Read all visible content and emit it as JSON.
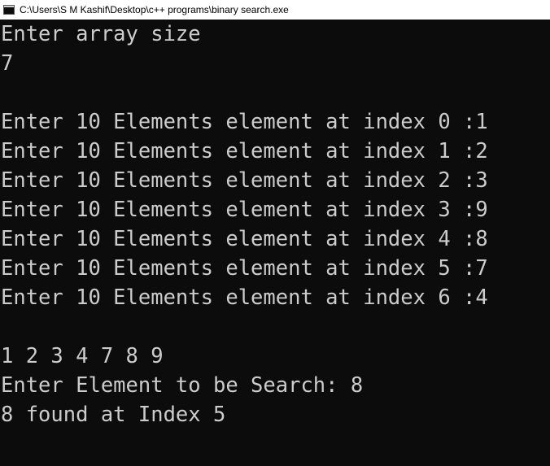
{
  "window": {
    "title": "C:\\Users\\S M Kashif\\Desktop\\c++ programs\\binary search.exe",
    "icon": "console-app-icon"
  },
  "console": {
    "lines": [
      "Enter array size",
      "7",
      "",
      "Enter 10 Elements element at index 0 :1",
      "Enter 10 Elements element at index 1 :2",
      "Enter 10 Elements element at index 2 :3",
      "Enter 10 Elements element at index 3 :9",
      "Enter 10 Elements element at index 4 :8",
      "Enter 10 Elements element at index 5 :7",
      "Enter 10 Elements element at index 6 :4",
      "",
      "1 2 3 4 7 8 9",
      "Enter Element to be Search: 8",
      "8 found at Index 5"
    ]
  },
  "colors": {
    "background": "#0c0c0c",
    "text": "#cccccc",
    "titlebar": "#ffffff"
  }
}
